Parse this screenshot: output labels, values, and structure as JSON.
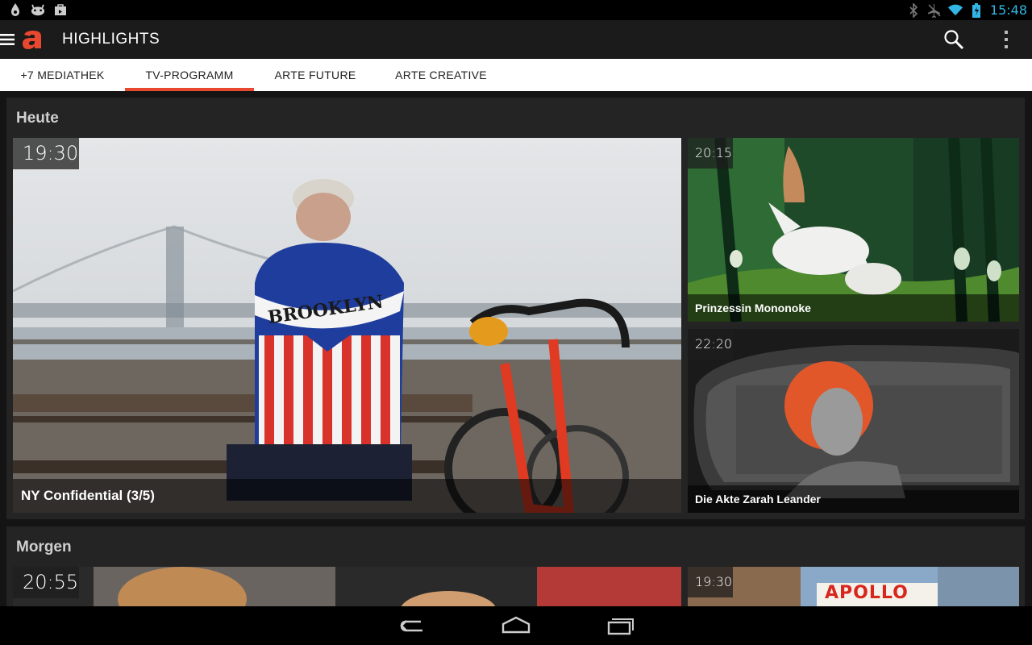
{
  "status_bar": {
    "time": "15:48",
    "left_icons": [
      "water-drop-icon",
      "android-icon",
      "shopping-bag-icon"
    ],
    "right_icons": [
      "bluetooth-icon",
      "airplane-off-icon",
      "wifi-icon",
      "battery-charging-icon"
    ]
  },
  "action_bar": {
    "title": "HIGHLIGHTS",
    "logo_letter": "a",
    "brand_color": "#e8482f"
  },
  "tabs": [
    {
      "label": "+7 MEDIATHEK",
      "active": false
    },
    {
      "label": "TV-PROGRAMM",
      "active": true
    },
    {
      "label": "ARTE FUTURE",
      "active": false
    },
    {
      "label": "ARTE CREATIVE",
      "active": false
    }
  ],
  "sections": [
    {
      "title": "Heute",
      "cards": [
        {
          "time": "19:30",
          "title": "NY Confidential (3/5)"
        },
        {
          "time": "20:15",
          "title": "Prinzessin Mononoke"
        },
        {
          "time": "22:20",
          "title": "Die Akte Zarah Leander"
        }
      ]
    },
    {
      "title": "Morgen",
      "cards": [
        {
          "time": "20:55",
          "title": ""
        },
        {
          "time": "19:30",
          "title": "",
          "sign_text": "APOLLO"
        }
      ]
    }
  ],
  "nav_bar": {
    "buttons": [
      "back-icon",
      "home-icon",
      "recent-apps-icon"
    ]
  }
}
